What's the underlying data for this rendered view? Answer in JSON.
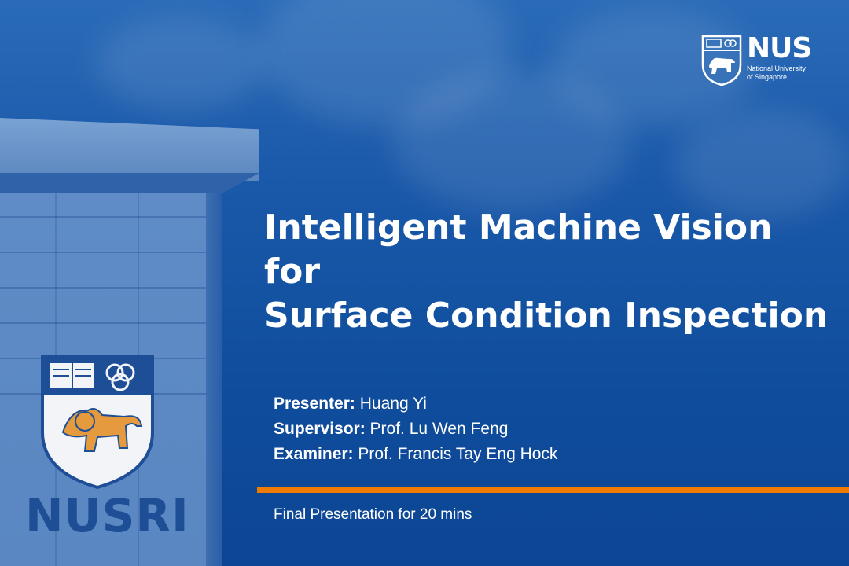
{
  "logo": {
    "name": "NUS",
    "subtitle_line1": "National University",
    "subtitle_line2": "of Singapore"
  },
  "building_sign": "NUSRI",
  "title": {
    "line1": "Intelligent Machine Vision for",
    "line2": "Surface Condition Inspection"
  },
  "people": [
    {
      "role": "Presenter:",
      "name": "Huang Yi"
    },
    {
      "role": "Supervisor:",
      "name": "Prof. Lu Wen Feng"
    },
    {
      "role": "Examiner:",
      "name": "Prof. Francis Tay Eng Hock"
    }
  ],
  "footer": "Final Presentation for 20 mins",
  "colors": {
    "accent_bar": "#ef7c00",
    "background": "#0f4f9e",
    "text": "#ffffff"
  }
}
